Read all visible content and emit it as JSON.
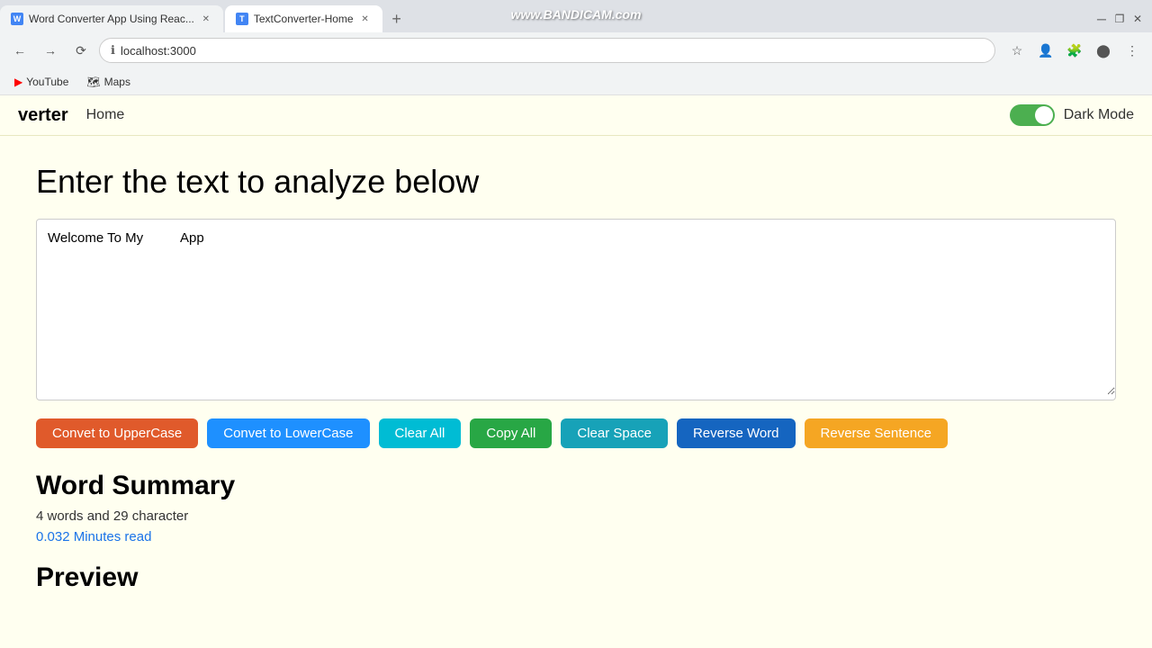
{
  "browser": {
    "tabs": [
      {
        "id": "tab1",
        "label": "Word Converter App Using Reac...",
        "active": false,
        "favicon": "W"
      },
      {
        "id": "tab2",
        "label": "TextConverter-Home",
        "active": true,
        "favicon": "T"
      }
    ],
    "address": "localhost:3000",
    "bandicam": "www.BANDICAM.com",
    "bookmarks": [
      {
        "label": "YouTube",
        "icon": "▶"
      },
      {
        "label": "Maps",
        "icon": "🗺"
      }
    ]
  },
  "navbar": {
    "brand": "verter",
    "links": [
      "Home"
    ],
    "dark_mode_label": "Dark Mode"
  },
  "main": {
    "page_title": "Enter the text to analyze below",
    "textarea_value": "Welcome To My          App",
    "textarea_placeholder": "",
    "buttons": [
      {
        "label": "Convet to UpperCase",
        "class": "btn-red"
      },
      {
        "label": "Convet to LowerCase",
        "class": "btn-blue"
      },
      {
        "label": "Clear All",
        "class": "btn-cyan"
      },
      {
        "label": "Copy All",
        "class": "btn-green"
      },
      {
        "label": "Clear Space",
        "class": "btn-teal"
      },
      {
        "label": "Reverse Word",
        "class": "btn-darkblue"
      },
      {
        "label": "Reverse Sentence",
        "class": "btn-orange"
      }
    ],
    "word_summary": {
      "title": "Word Summary",
      "word_count_text": "4 words and 29 character",
      "reading_time": "0.032 Minutes read"
    },
    "preview": {
      "title": "Preview"
    }
  }
}
